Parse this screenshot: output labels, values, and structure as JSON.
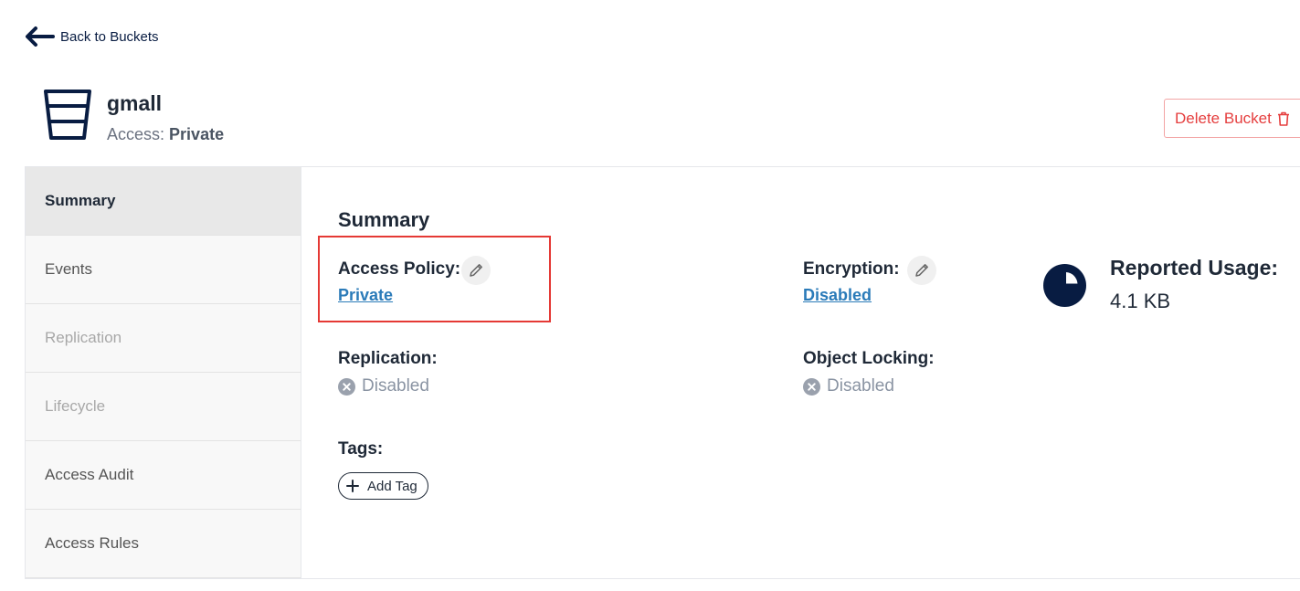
{
  "nav": {
    "back_label": "Back to Buckets"
  },
  "bucket": {
    "name": "gmall",
    "access_prefix": "Access:",
    "access_value": "Private"
  },
  "actions": {
    "delete_label": "Delete Bucket"
  },
  "sidebar": {
    "items": [
      {
        "label": "Summary",
        "state": "active"
      },
      {
        "label": "Events",
        "state": "enabled"
      },
      {
        "label": "Replication",
        "state": "disabled"
      },
      {
        "label": "Lifecycle",
        "state": "disabled"
      },
      {
        "label": "Access Audit",
        "state": "enabled"
      },
      {
        "label": "Access Rules",
        "state": "enabled"
      }
    ]
  },
  "summary": {
    "title": "Summary",
    "access_policy": {
      "label": "Access Policy:",
      "value": "Private"
    },
    "encryption": {
      "label": "Encryption:",
      "value": "Disabled"
    },
    "replication": {
      "label": "Replication:",
      "status": "Disabled"
    },
    "object_locking": {
      "label": "Object Locking:",
      "status": "Disabled"
    },
    "tags": {
      "label": "Tags:",
      "add_label": "Add Tag"
    },
    "usage": {
      "label": "Reported Usage:",
      "value": "4.1 KB"
    }
  },
  "colors": {
    "brand_dark": "#081c42",
    "danger": "#e53e3e",
    "link": "#2b7bb9",
    "highlight": "#e53935"
  },
  "icons": [
    "back-arrow-icon",
    "bucket-icon",
    "trash-icon",
    "pencil-icon",
    "x-circle-icon",
    "pie-chart-icon",
    "plus-icon"
  ]
}
